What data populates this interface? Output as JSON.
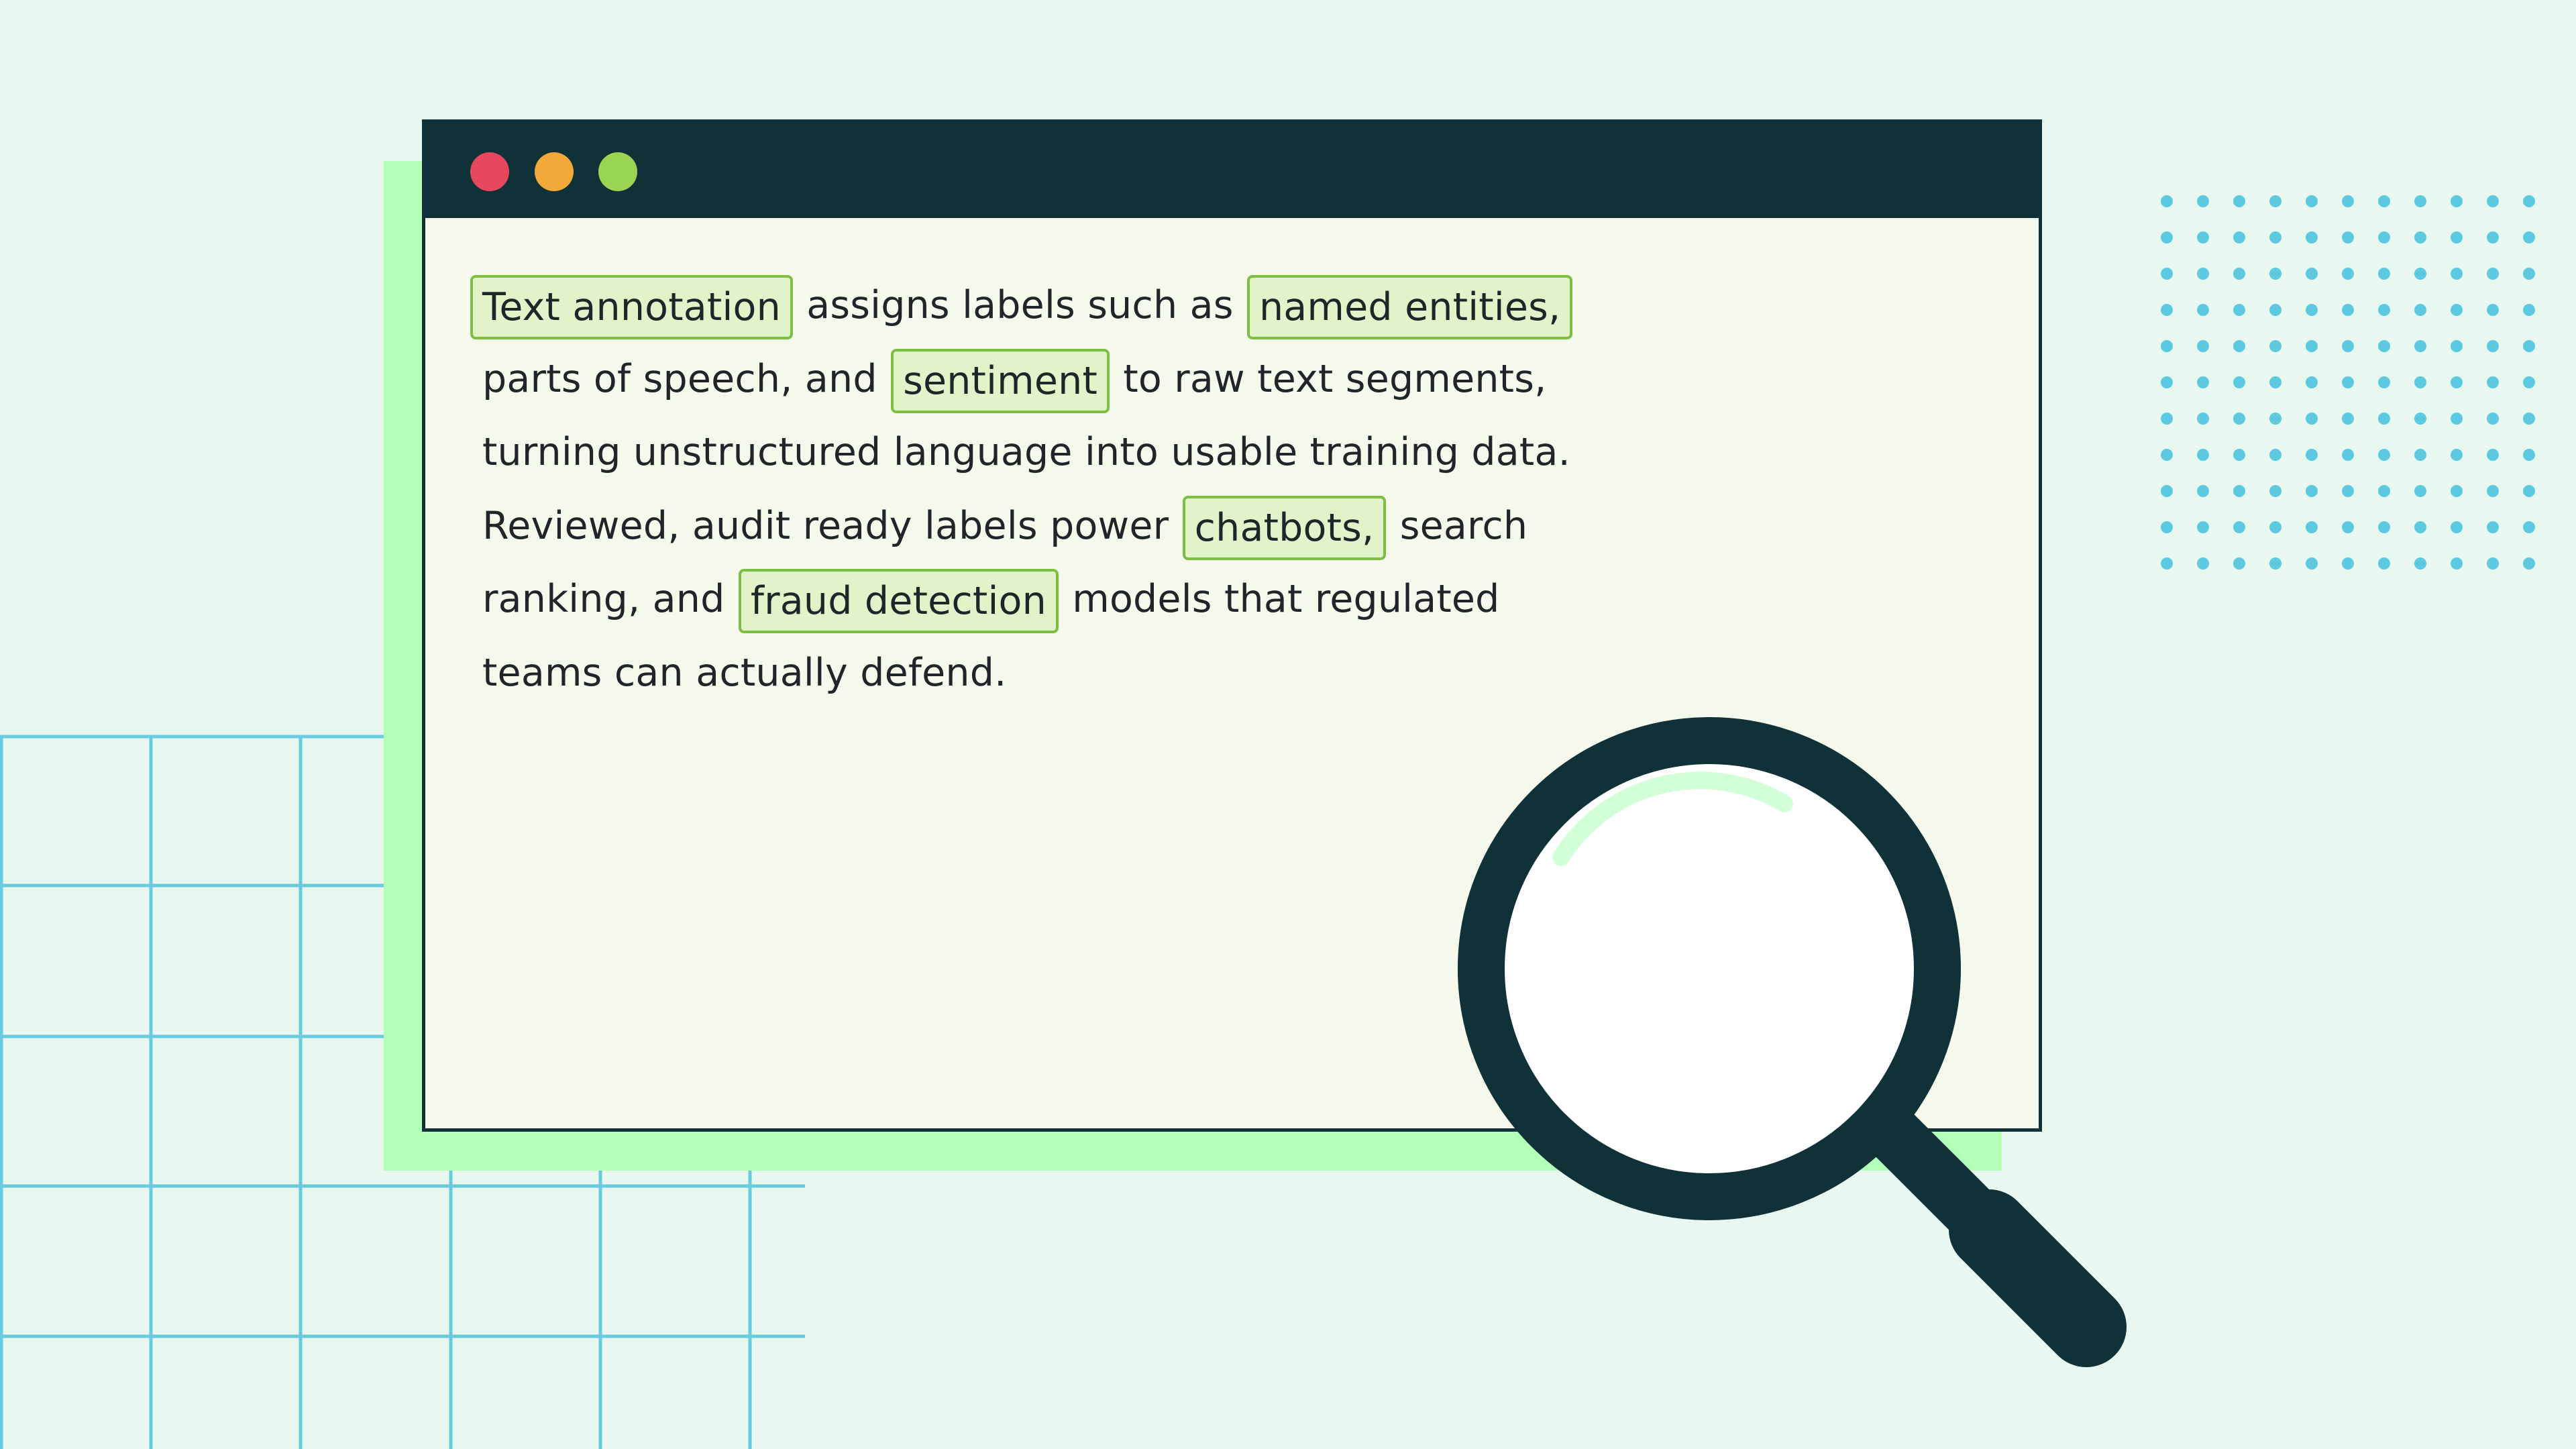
{
  "window": {
    "controls": [
      {
        "name": "close",
        "color": "#e8485e"
      },
      {
        "name": "minimize",
        "color": "#f3a93a"
      },
      {
        "name": "maximize",
        "color": "#99d452"
      }
    ]
  },
  "annotation_text": {
    "line1": {
      "tag1": "Text annotation",
      "text1": "assigns labels such as",
      "tag2": "named entities,"
    },
    "line2": {
      "text1": "parts of speech, and",
      "tag1": "sentiment",
      "text2": "to raw text segments,"
    },
    "line3": {
      "text1": "turning unstructured language into usable training data."
    },
    "line4": {
      "text1": "Reviewed, audit ready labels power",
      "tag1": "chatbots,",
      "text2": "search"
    },
    "line5": {
      "text1": "ranking, and",
      "tag1": "fraud detection",
      "text2": "models that regulated"
    },
    "line6": {
      "text1": "teams can actually defend."
    }
  },
  "colors": {
    "background": "#e8f8f1",
    "backdrop": "#b3ffb8",
    "window_bg": "#f4f9ec",
    "titlebar": "#0f3137",
    "tag_border": "#7dbf42",
    "tag_fill": "#e2f3c9",
    "grid_line": "#69cbdf",
    "dots": "#5cc9e0",
    "magnifier": "#0f3137",
    "magnifier_glint": "#d2ffd8"
  },
  "decorations": {
    "grid_icon": "grid-pattern",
    "dot_icon": "dot-matrix",
    "magnifier_icon": "magnifying-glass-icon"
  }
}
